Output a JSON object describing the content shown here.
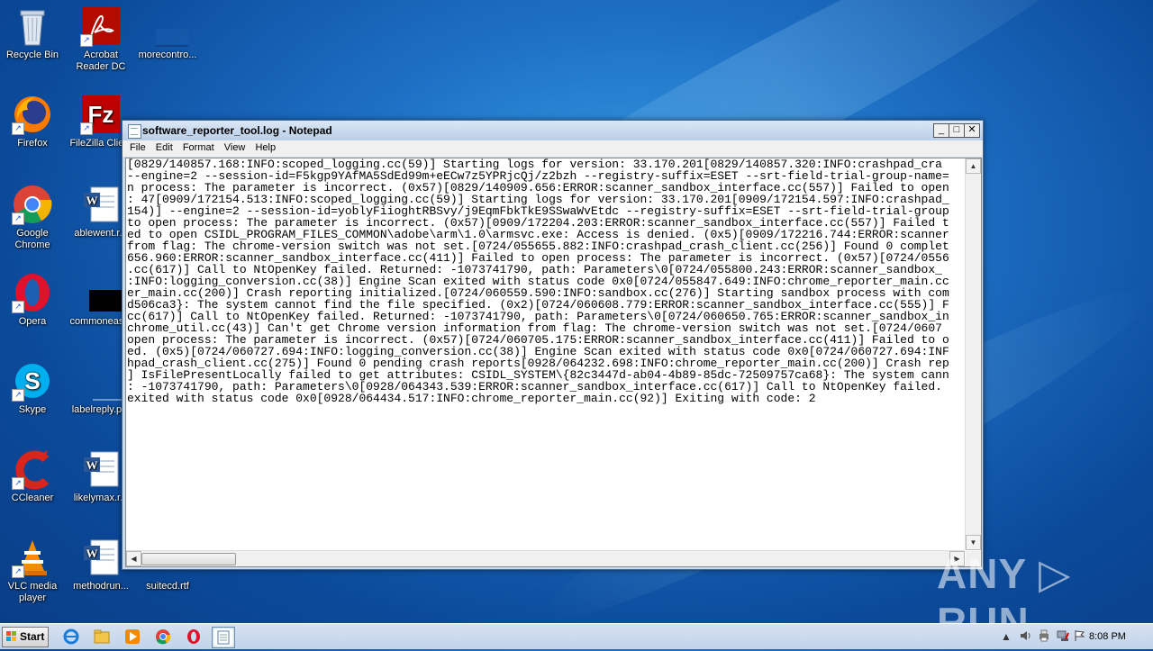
{
  "desktop_icons": [
    {
      "label": "Recycle Bin"
    },
    {
      "label": "Acrobat Reader DC"
    },
    {
      "label": "morecontro..."
    },
    {
      "label": "Firefox"
    },
    {
      "label": "FileZilla Clie..."
    },
    {
      "label": "Google Chrome"
    },
    {
      "label": "ablewent.r..."
    },
    {
      "label": "Opera"
    },
    {
      "label": "commoneas..."
    },
    {
      "label": "Skype"
    },
    {
      "label": "labelreply.p..."
    },
    {
      "label": "CCleaner"
    },
    {
      "label": "likelymax.r..."
    },
    {
      "label": "VLC media player"
    },
    {
      "label": "methodrun..."
    },
    {
      "label": "suitecd.rtf"
    }
  ],
  "window": {
    "title": "software_reporter_tool.log - Notepad",
    "min_label": "_",
    "max_label": "□",
    "close_label": "✕",
    "menu": [
      "File",
      "Edit",
      "Format",
      "View",
      "Help"
    ]
  },
  "log_lines": [
    "[0829/140857.168:INFO:scoped_logging.cc(59)] Starting logs for version: 33.170.201[0829/140857.320:INFO:crashpad_cra",
    "--engine=2 --session-id=F5kgp9YAfMA5SdEd99m+eECw7z5YPRjcQj/z2bzh --registry-suffix=ESET --srt-field-trial-group-name=",
    "n process: The parameter is incorrect. (0x57)[0829/140909.656:ERROR:scanner_sandbox_interface.cc(557)] Failed to open",
    ": 47[0909/172154.513:INFO:scoped_logging.cc(59)] Starting logs for version: 33.170.201[0909/172154.597:INFO:crashpad_",
    "154)] --engine=2 --session-id=yoblyFiioghtRBSvy/j9EqmFbkTkE9SSwaWvEtdc --registry-suffix=ESET --srt-field-trial-group",
    "to open process: The parameter is incorrect. (0x57)[0909/172204.203:ERROR:scanner_sandbox_interface.cc(557)] Failed t",
    "ed to open CSIDL_PROGRAM_FILES_COMMON\\adobe\\arm\\1.0\\armsvc.exe: Access is denied. (0x5)[0909/172216.744:ERROR:scanner",
    "from flag: The chrome-version switch was not set.[0724/055655.882:INFO:crashpad_crash_client.cc(256)] Found 0 complet",
    "656.960:ERROR:scanner_sandbox_interface.cc(411)] Failed to open process: The parameter is incorrect. (0x57)[0724/0556",
    ".cc(617)] Call to NtOpenKey failed. Returned: -1073741790, path: Parameters\\0[0724/055800.243:ERROR:scanner_sandbox_",
    ":INFO:logging_conversion.cc(38)] Engine Scan exited with status code 0x0[0724/055847.649:INFO:chrome_reporter_main.cc",
    "er_main.cc(200)] Crash reporting initialized.[0724/060559.590:INFO:sandbox.cc(276)] Starting sandbox process with com",
    "d506ca3}: The system cannot find the file specified. (0x2)[0724/060608.779:ERROR:scanner_sandbox_interface.cc(555)] F",
    "cc(617)] Call to NtOpenKey failed. Returned: -1073741790, path: Parameters\\0[0724/060650.765:ERROR:scanner_sandbox_in",
    "chrome_util.cc(43)] Can't get Chrome version information from flag: The chrome-version switch was not set.[0724/0607",
    "open process: The parameter is incorrect. (0x57)[0724/060705.175:ERROR:scanner_sandbox_interface.cc(411)] Failed to o",
    "ed. (0x5)[0724/060727.694:INFO:logging_conversion.cc(38)] Engine Scan exited with status code 0x0[0724/060727.694:INF",
    "hpad_crash_client.cc(275)] Found 0 pending crash reports[0928/064232.698:INFO:chrome_reporter_main.cc(200)] Crash rep",
    "] IsFilePresentLocally failed to get attributes: CSIDL_SYSTEM\\{82c3447d-ab04-4b89-85dc-72509757ca68}: The system cann",
    ": -1073741790, path: Parameters\\0[0928/064343.539:ERROR:scanner_sandbox_interface.cc(617)] Call to NtOpenKey failed.",
    "exited with status code 0x0[0928/064434.517:INFO:chrome_reporter_main.cc(92)] Exiting with code: 2"
  ],
  "watermark": "ANY ▷ RUN",
  "taskbar": {
    "start_label": "Start",
    "clock": "8:08 PM"
  },
  "icons": {
    "tray": [
      "chevron-up-icon",
      "speaker-icon",
      "printer-icon",
      "network-icon",
      "flag-icon"
    ]
  }
}
